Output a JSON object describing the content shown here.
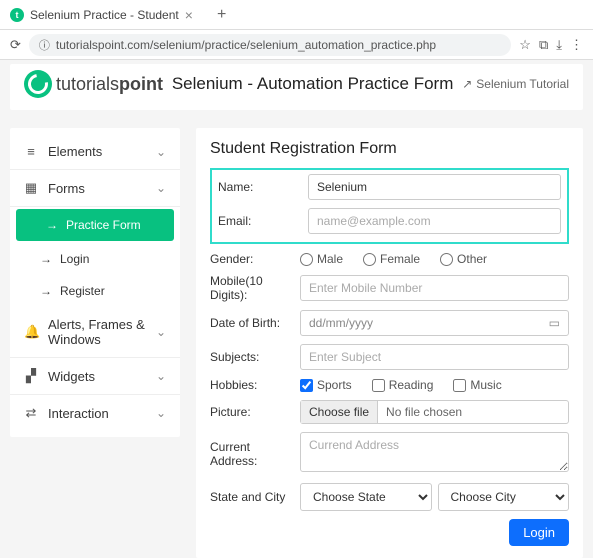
{
  "browser": {
    "tab_title": "Selenium Practice - Student",
    "url": "tutorialspoint.com/selenium/practice/selenium_automation_practice.php"
  },
  "header": {
    "logo_a": "tutorials",
    "logo_b": "point",
    "title": "Selenium - Automation Practice Form",
    "tutorial_link": "Selenium Tutorial"
  },
  "sidebar": {
    "elements": "Elements",
    "forms": "Forms",
    "practice_form": "Practice Form",
    "login": "Login",
    "register": "Register",
    "alerts": "Alerts, Frames & Windows",
    "widgets": "Widgets",
    "interaction": "Interaction"
  },
  "form": {
    "title": "Student Registration Form",
    "name_label": "Name:",
    "name_value": "Selenium",
    "email_label": "Email:",
    "email_placeholder": "name@example.com",
    "gender_label": "Gender:",
    "gender_male": "Male",
    "gender_female": "Female",
    "gender_other": "Other",
    "mobile_label": "Mobile(10 Digits):",
    "mobile_placeholder": "Enter Mobile Number",
    "dob_label": "Date of Birth:",
    "dob_placeholder": "dd/mm/yyyy",
    "subjects_label": "Subjects:",
    "subjects_placeholder": "Enter Subject",
    "hobbies_label": "Hobbies:",
    "hobby_sports": "Sports",
    "hobby_reading": "Reading",
    "hobby_music": "Music",
    "picture_label": "Picture:",
    "choose_file": "Choose file",
    "no_file": "No file chosen",
    "address_label": "Current Address:",
    "address_placeholder": "Currend Address",
    "state_city_label": "State and City",
    "choose_state": "Choose State",
    "choose_city": "Choose City",
    "login_btn": "Login"
  }
}
